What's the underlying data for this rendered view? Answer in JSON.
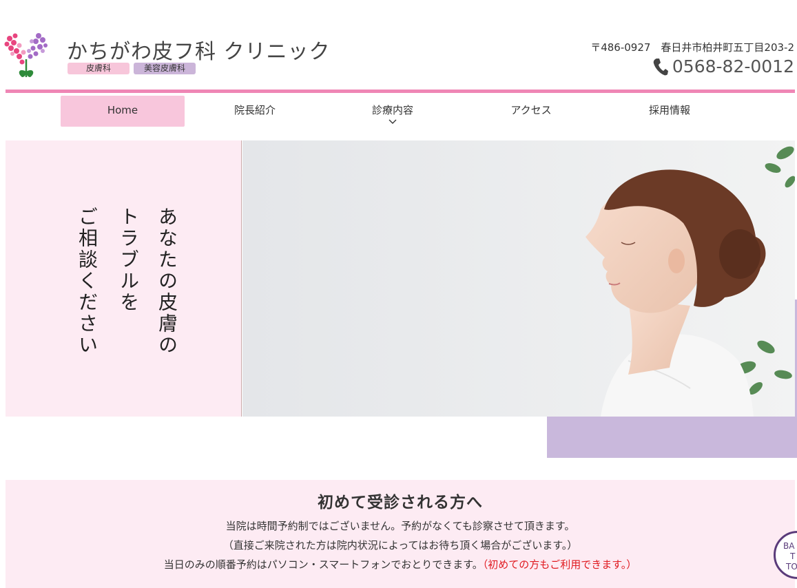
{
  "header": {
    "clinic_name": "かちがわ皮フ科 クリニック",
    "tags": [
      "皮膚科",
      "美容皮膚科"
    ],
    "address": "〒486-0927　春日井市柏井町五丁目203-2",
    "phone": "0568-82-0012",
    "icons": {
      "logo": "flower-logo-icon",
      "phone": "phone-icon"
    }
  },
  "nav": {
    "items": [
      {
        "label": "Home",
        "active": true
      },
      {
        "label": "院長紹介"
      },
      {
        "label": "診療内容",
        "has_dropdown": true
      },
      {
        "label": "アクセス"
      },
      {
        "label": "採用情報"
      }
    ]
  },
  "hero": {
    "catch_lines": [
      "あなたの皮膚の",
      "トラブルを",
      "ご相談ください"
    ]
  },
  "intro": {
    "title": "初めて受診される方へ",
    "line1": "当院は時間予約制ではございません。予約がなくても診察させて頂きます。",
    "line2": "（直接ご来院された方は院内状況によってはお待ち頂く場合がございます。）",
    "line3": "当日のみの順番予約はパソコン・スマートフォンでおとりできます。",
    "line3_note": "（初めての方もご利用できます。）"
  },
  "back_to_top": {
    "lines": [
      "BA",
      "T",
      "TO"
    ]
  },
  "colors": {
    "pink_rule": "#ef86b5",
    "pink_bg": "#fdebf3",
    "nav_active": "#f8c6dc",
    "lavender": "#c9b8dc",
    "note_red": "#e0191f"
  }
}
